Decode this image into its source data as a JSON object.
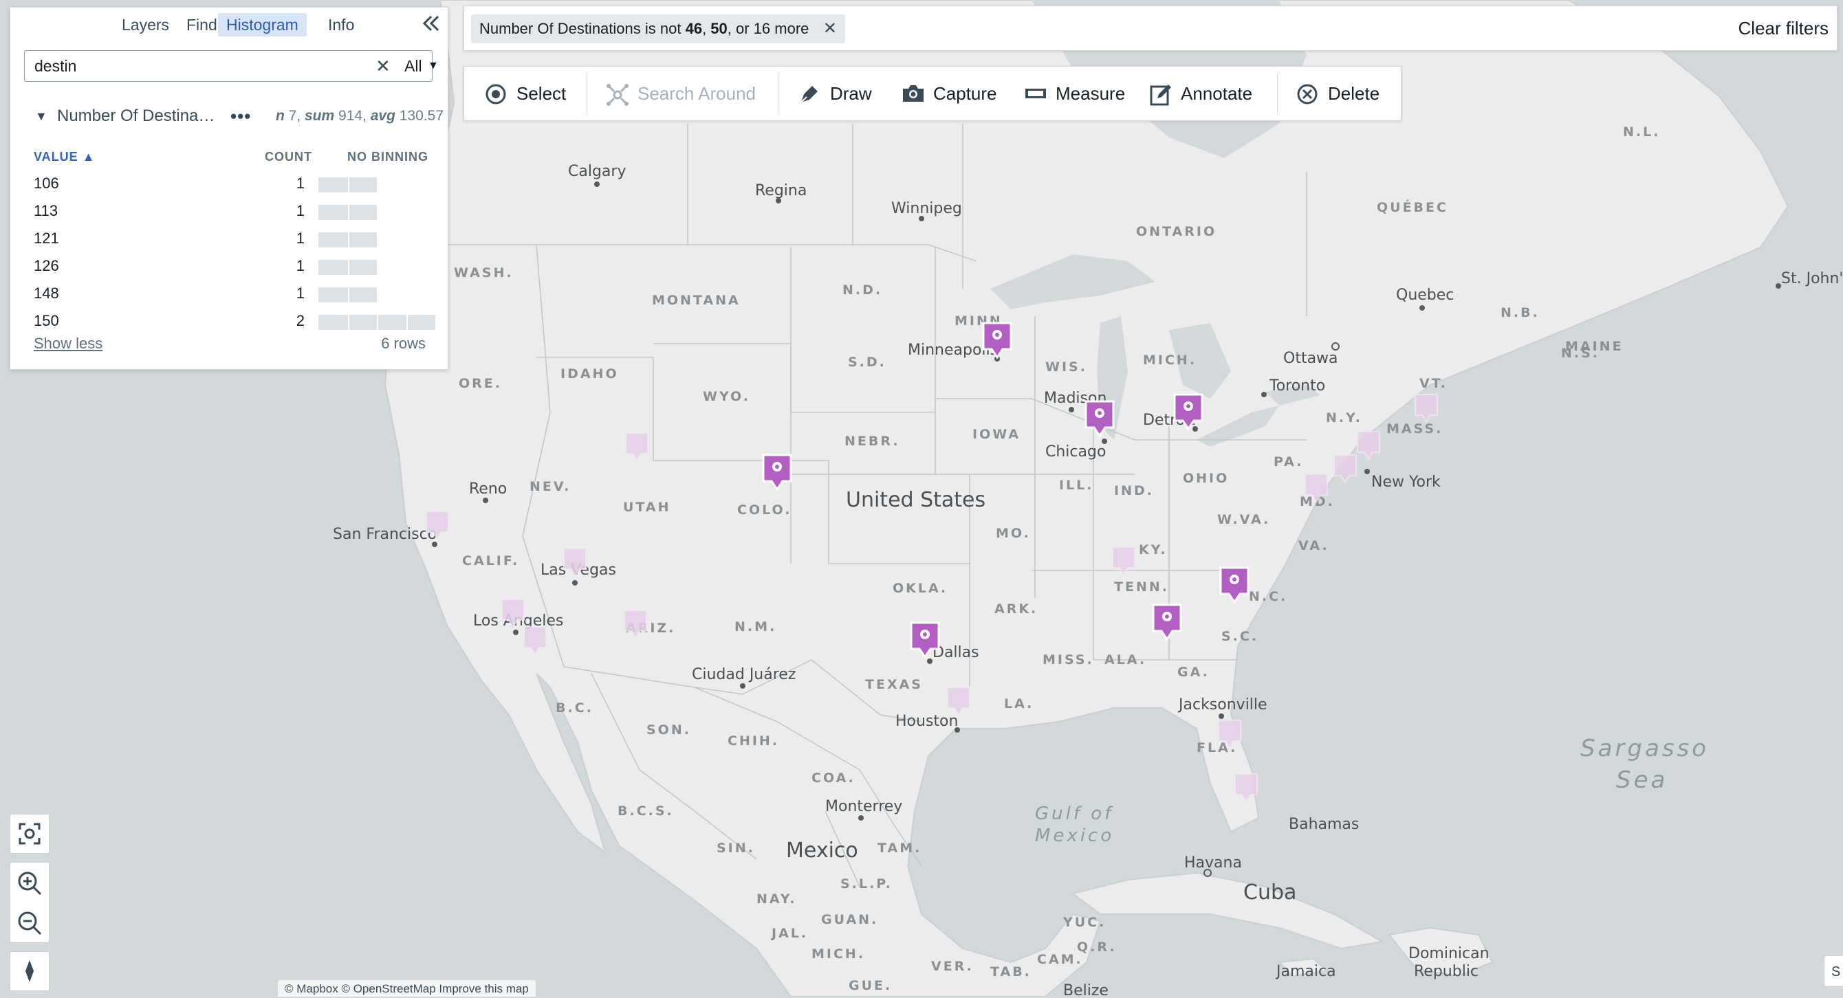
{
  "panel": {
    "tabs": [
      "Layers",
      "Find",
      "Histogram",
      "Info"
    ],
    "active_tab": "Histogram",
    "collapse_icon": "double-chevron-left-icon",
    "search": {
      "value": "destin",
      "scope": "All"
    },
    "property": {
      "name": "Number Of Destina…",
      "stats_n_label": "n",
      "stats_n": "7",
      "stats_sum_label": "sum",
      "stats_sum": "914",
      "stats_avg_label": "avg",
      "stats_avg": "130.57"
    },
    "columns": {
      "value": "VALUE",
      "count": "COUNT",
      "binning": "NO BINNING"
    },
    "rows": [
      {
        "value": "106",
        "count": "1",
        "fraction": 0.5
      },
      {
        "value": "113",
        "count": "1",
        "fraction": 0.5
      },
      {
        "value": "121",
        "count": "1",
        "fraction": 0.5
      },
      {
        "value": "126",
        "count": "1",
        "fraction": 0.5
      },
      {
        "value": "148",
        "count": "1",
        "fraction": 0.5
      },
      {
        "value": "150",
        "count": "2",
        "fraction": 1.0
      }
    ],
    "show_less": "Show less",
    "row_count": "6 rows"
  },
  "filter": {
    "prefix": "Number Of Destinations is not ",
    "v1": "46",
    "sep1": ", ",
    "v2": "50",
    "suffix": ", or 16 more",
    "clear": "Clear filters"
  },
  "toolbar": {
    "select": "Select",
    "search_around": "Search Around",
    "draw": "Draw",
    "capture": "Capture",
    "measure": "Measure",
    "annotate": "Annotate",
    "delete": "Delete"
  },
  "attribution": "© Mapbox © OpenStreetMap Improve this map",
  "corner_widget": "S",
  "map": {
    "country_labels": [
      "United States",
      "Mexico",
      "Cuba"
    ],
    "water_labels": [
      "Sargasso",
      "Sea",
      "Gulf of",
      "Mexico"
    ],
    "region_labels": [
      "N.L.",
      "QUÉBEC",
      "ONTARIO",
      "WASH.",
      "MONTANA",
      "N.D.",
      "MINN.",
      "WIS.",
      "MICH.",
      "S.D.",
      "WYO.",
      "IDAHO",
      "ORE.",
      "NEBR.",
      "IOWA",
      "N.B.",
      "MAINE",
      "N.S.",
      "VT.",
      "N.Y.",
      "MASS.",
      "PA.",
      "OHIO",
      "IND.",
      "ILL.",
      "NEV.",
      "UTAH",
      "COLO.",
      "MO.",
      "W.VA.",
      "VA.",
      "MD.",
      "KY.",
      "CALIF.",
      "TENN.",
      "N.C.",
      "OKLA.",
      "ARK.",
      "S.C.",
      "ARIZ.",
      "N.M.",
      "MISS.",
      "ALA.",
      "GA.",
      "TEXAS",
      "LA.",
      "FLA.",
      "B.C.",
      "SON.",
      "CHIH.",
      "COA.",
      "B.C.S.",
      "SIN.",
      "TAM.",
      "S.L.P.",
      "NAY.",
      "GUAN.",
      "JAL.",
      "MICH.",
      "VER.",
      "TAB.",
      "CAM.",
      "YUC.",
      "Q.R.",
      "GUE."
    ],
    "city_labels": [
      "Calgary",
      "Regina",
      "Winnipeg",
      "Quebec",
      "St. John's",
      "Ottawa",
      "Toronto",
      "Minneapolis",
      "Madison",
      "Chicago",
      "Detroit",
      "New York",
      "Reno",
      "San Francisco",
      "Las Vegas",
      "Los Angeles",
      "Dallas",
      "Houston",
      "Ciudad Juárez",
      "Jacksonville",
      "Monterrey",
      "Havana",
      "Bahamas",
      "Jamaica",
      "Dominican",
      "Republic",
      "Belize"
    ],
    "accent_color": "#b35ec2"
  }
}
